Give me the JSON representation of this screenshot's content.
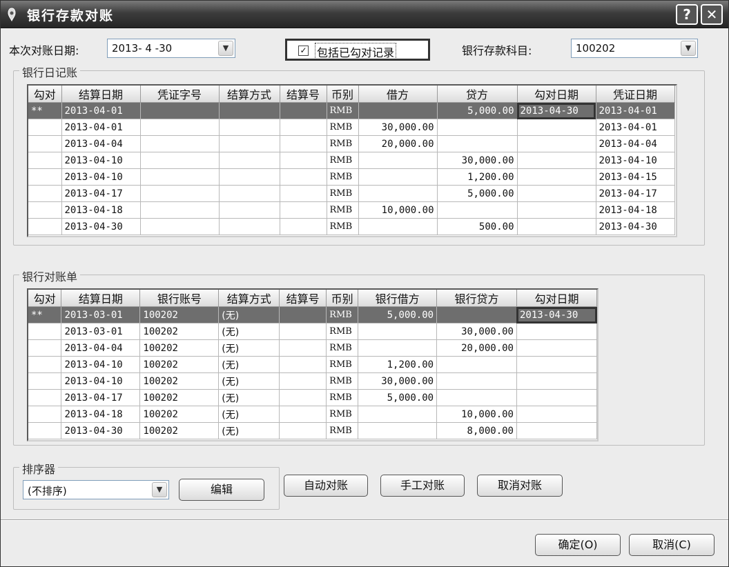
{
  "window": {
    "title": "银行存款对账",
    "help_label": "?",
    "close_label": "✕"
  },
  "header": {
    "date_label": "本次对账日期:",
    "date_value": "2013- 4 -30",
    "include_checked_label": "包括已勾对记录",
    "include_checked": true,
    "account_label": "银行存款科目:",
    "account_value": "100202"
  },
  "journal": {
    "group_title": "银行日记账",
    "columns": [
      "勾对",
      "结算日期",
      "凭证字号",
      "结算方式",
      "结算号",
      "币别",
      "借方",
      "贷方",
      "勾对日期",
      "凭证日期"
    ],
    "rows": [
      [
        "**",
        "2013-04-01",
        "",
        "",
        "",
        "RMB",
        "",
        "5,000.00",
        "2013-04-30",
        "2013-04-01"
      ],
      [
        "",
        "2013-04-01",
        "",
        "",
        "",
        "RMB",
        "30,000.00",
        "",
        "",
        "2013-04-01"
      ],
      [
        "",
        "2013-04-04",
        "",
        "",
        "",
        "RMB",
        "20,000.00",
        "",
        "",
        "2013-04-04"
      ],
      [
        "",
        "2013-04-10",
        "",
        "",
        "",
        "RMB",
        "",
        "30,000.00",
        "",
        "2013-04-10"
      ],
      [
        "",
        "2013-04-10",
        "",
        "",
        "",
        "RMB",
        "",
        "1,200.00",
        "",
        "2013-04-15"
      ],
      [
        "",
        "2013-04-17",
        "",
        "",
        "",
        "RMB",
        "",
        "5,000.00",
        "",
        "2013-04-17"
      ],
      [
        "",
        "2013-04-18",
        "",
        "",
        "",
        "RMB",
        "10,000.00",
        "",
        "",
        "2013-04-18"
      ],
      [
        "",
        "2013-04-30",
        "",
        "",
        "",
        "RMB",
        "",
        "500.00",
        "",
        "2013-04-30"
      ]
    ]
  },
  "statement": {
    "group_title": "银行对账单",
    "columns": [
      "勾对",
      "结算日期",
      "银行账号",
      "结算方式",
      "结算号",
      "币别",
      "银行借方",
      "银行贷方",
      "勾对日期"
    ],
    "rows": [
      [
        "**",
        "2013-03-01",
        "100202",
        "(无)",
        "",
        "RMB",
        "5,000.00",
        "",
        "2013-04-30"
      ],
      [
        "",
        "2013-03-01",
        "100202",
        "(无)",
        "",
        "RMB",
        "",
        "30,000.00",
        ""
      ],
      [
        "",
        "2013-04-04",
        "100202",
        "(无)",
        "",
        "RMB",
        "",
        "20,000.00",
        ""
      ],
      [
        "",
        "2013-04-10",
        "100202",
        "(无)",
        "",
        "RMB",
        "1,200.00",
        "",
        ""
      ],
      [
        "",
        "2013-04-10",
        "100202",
        "(无)",
        "",
        "RMB",
        "30,000.00",
        "",
        ""
      ],
      [
        "",
        "2013-04-17",
        "100202",
        "(无)",
        "",
        "RMB",
        "5,000.00",
        "",
        ""
      ],
      [
        "",
        "2013-04-18",
        "100202",
        "(无)",
        "",
        "RMB",
        "",
        "10,000.00",
        ""
      ],
      [
        "",
        "2013-04-30",
        "100202",
        "(无)",
        "",
        "RMB",
        "",
        "8,000.00",
        ""
      ]
    ]
  },
  "sorter": {
    "group_title": "排序器",
    "value": "(不排序)",
    "edit_label": "编辑"
  },
  "actions": {
    "auto_label": "自动对账",
    "manual_label": "手工对账",
    "cancel_match_label": "取消对账"
  },
  "footer": {
    "ok_label": "确定(O)",
    "cancel_label": "取消(C)"
  }
}
